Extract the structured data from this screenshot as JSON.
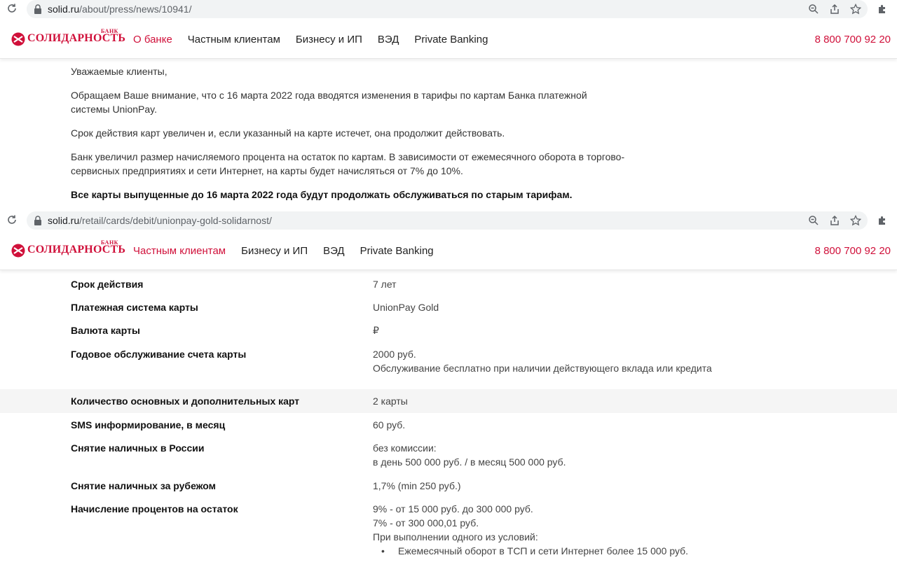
{
  "screenshot_1": {
    "url_host": "solid.ru",
    "url_path": "/about/press/news/10941/",
    "logo": {
      "bank_word": "БАНК",
      "bank_name": "СОЛИДАРНОСТЬ"
    },
    "nav": [
      {
        "label": "О банке",
        "active": true
      },
      {
        "label": "Частным клиентам",
        "active": false
      },
      {
        "label": "Бизнесу и ИП",
        "active": false
      },
      {
        "label": "ВЭД",
        "active": false
      },
      {
        "label": "Private Banking",
        "active": false
      }
    ],
    "phone": "8 800 700 92 20",
    "paragraphs": [
      "Уважаемые клиенты,",
      "Обращаем Ваше внимание, что с 16 марта 2022 года вводятся изменения в тарифы по картам Банка платежной системы UnionPay.",
      "Срок действия карт увеличен и, если указанный на карте истечет, она продолжит действовать.",
      "Банк увеличил размер начисляемого процента на остаток по картам. В зависимости от ежемесячного оборота в торгово-сервисных предприятиях и сети Интернет, на карты будет начисляться от 7% до 10%."
    ],
    "bold_paragraph": "Все карты выпущенные до 16 марта 2022 года  будут продолжать обслуживаться по старым тарифам."
  },
  "screenshot_2": {
    "url_host": "solid.ru",
    "url_path": "/retail/cards/debit/unionpay-gold-solidarnost/",
    "logo": {
      "bank_word": "БАНК",
      "bank_name": "СОЛИДАРНОСТЬ"
    },
    "nav": [
      {
        "label": "Частным клиентам",
        "active": true
      },
      {
        "label": "Бизнесу и ИП",
        "active": false
      },
      {
        "label": "ВЭД",
        "active": false
      },
      {
        "label": "Private Banking",
        "active": false
      }
    ],
    "phone": "8 800 700 92 20",
    "specs": [
      {
        "key": "Срок действия",
        "lines": [
          "7 лет"
        ]
      },
      {
        "key": "Платежная система карты",
        "lines": [
          "UnionPay Gold"
        ]
      },
      {
        "key": "Валюта карты",
        "lines": [
          "₽"
        ]
      },
      {
        "key": "Годовое обслуживание счета карты",
        "lines": [
          "2000 руб.",
          "Обслуживание бесплатно при наличии действующего вклада или кредита"
        ]
      },
      {
        "key": "Количество основных и дополнительных карт",
        "lines": [
          "2 карты"
        ]
      },
      {
        "key": "SMS информирование, в месяц",
        "lines": [
          "60 руб."
        ]
      },
      {
        "key": "Снятие наличных в России",
        "lines": [
          "без комиссии:",
          "в день 500 000 руб. / в месяц 500 000 руб."
        ]
      },
      {
        "key": "Снятие наличных за рубежом",
        "lines": [
          "1,7% (min 250 руб.)"
        ]
      },
      {
        "key": "Начисление процентов на остаток",
        "lines": [
          "9% - от 15 000 руб. до 300 000 руб.",
          "7% - от 300 000,01 руб.",
          "При выполнении одного из условий:"
        ],
        "bullets": [
          "Ежемесячный оборот в ТСП и сети Интернет более 15 000 руб."
        ]
      }
    ]
  },
  "colors": {
    "brand_red": "#d0103a",
    "text": "#333333",
    "row_shade": "#f5f5f5"
  }
}
